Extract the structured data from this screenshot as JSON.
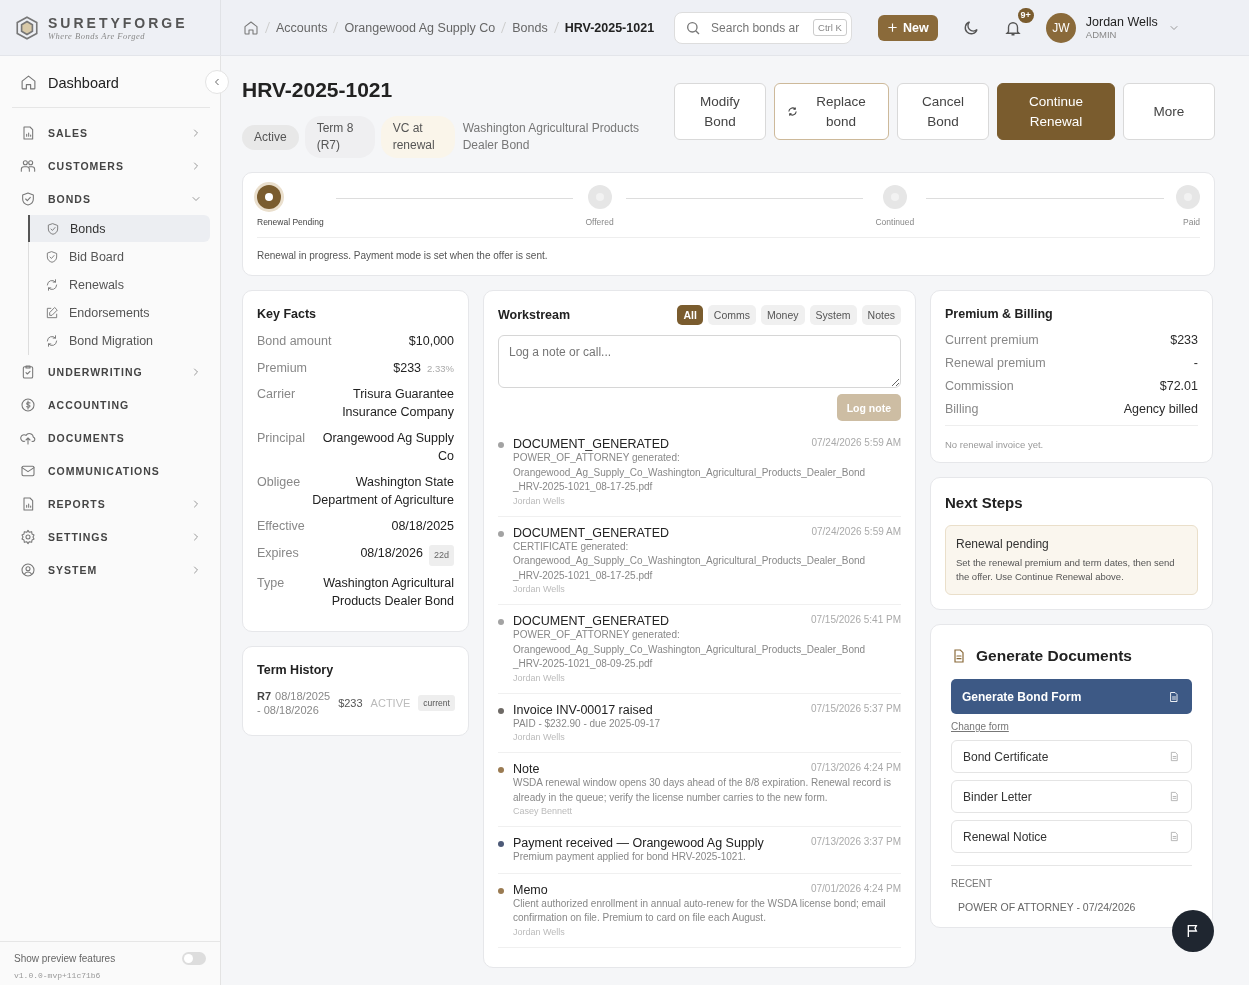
{
  "brand": {
    "name": "SURETYFORGE",
    "tagline": "Where Bonds Are Forged"
  },
  "sidebar": {
    "dashboard": {
      "label": "Dashboard"
    },
    "sections": [
      {
        "label": "SALES",
        "expandable": true,
        "expanded": false
      },
      {
        "label": "CUSTOMERS",
        "expandable": true,
        "expanded": false
      },
      {
        "label": "BONDS",
        "expandable": true,
        "expanded": true,
        "children": [
          {
            "label": "Bonds",
            "selected": true
          },
          {
            "label": "Bid Board",
            "selected": false
          },
          {
            "label": "Renewals",
            "selected": false
          },
          {
            "label": "Endorsements",
            "selected": false
          },
          {
            "label": "Bond Migration",
            "selected": false
          }
        ]
      },
      {
        "label": "UNDERWRITING",
        "expandable": true,
        "expanded": false
      },
      {
        "label": "ACCOUNTING",
        "expandable": false
      },
      {
        "label": "DOCUMENTS",
        "expandable": false
      },
      {
        "label": "COMMUNICATIONS",
        "expandable": false
      },
      {
        "label": "REPORTS",
        "expandable": true,
        "expanded": false
      },
      {
        "label": "SETTINGS",
        "expandable": true,
        "expanded": false
      },
      {
        "label": "SYSTEM",
        "expandable": true,
        "expanded": false
      }
    ],
    "preview": {
      "label": "Show preview features",
      "on": false
    },
    "version": "v1.0.0-mvp+11c71b6"
  },
  "topbar": {
    "breadcrumbs": [
      "Accounts",
      "Orangewood Ag Supply Co",
      "Bonds",
      "HRV-2025-1021"
    ],
    "search": {
      "placeholder": "Search bonds ar",
      "shortcut": "Ctrl K"
    },
    "new_button": "New",
    "notification_badge": "9+",
    "user": {
      "initials": "JW",
      "name": "Jordan Wells",
      "role": "ADMIN"
    }
  },
  "header": {
    "title": "HRV-2025-1021",
    "chips": [
      {
        "label": "Active",
        "kind": "status"
      },
      {
        "label": "Term 8 (R7)",
        "kind": "term"
      },
      {
        "label": "VC at renewal",
        "kind": "warm"
      }
    ],
    "description": "Washington Agricultural Products Dealer Bond",
    "actions": [
      {
        "label": "Modify Bond",
        "kind": "outline"
      },
      {
        "label": "Replace bond",
        "kind": "replace"
      },
      {
        "label": "Cancel Bond",
        "kind": "outline"
      },
      {
        "label": "Continue Renewal",
        "kind": "primary"
      },
      {
        "label": "More",
        "kind": "outline"
      }
    ]
  },
  "progress": {
    "steps": [
      {
        "label": "Renewal Pending",
        "current": true
      },
      {
        "label": "Offered",
        "current": false
      },
      {
        "label": "Continued",
        "current": false
      },
      {
        "label": "Paid",
        "current": false
      }
    ],
    "note": "Renewal in progress. Payment mode is set when the offer is sent."
  },
  "key_facts": {
    "title": "Key Facts",
    "rows": [
      {
        "label": "Bond amount",
        "value": "$10,000"
      },
      {
        "label": "Premium",
        "value": "$233",
        "extra": "2.33%"
      },
      {
        "label": "Carrier",
        "value": "Trisura Guarantee Insurance Company"
      },
      {
        "label": "Principal",
        "value": "Orangewood Ag Supply Co"
      },
      {
        "label": "Obligee",
        "value": "Washington State Department of Agriculture"
      },
      {
        "label": "Effective",
        "value": "08/18/2025"
      },
      {
        "label": "Expires",
        "value": "08/18/2026",
        "badge": "22d"
      },
      {
        "label": "Type",
        "value": "Washington Agricultural Products Dealer Bond"
      }
    ]
  },
  "term_history": {
    "title": "Term History",
    "rows": [
      {
        "term": "R7",
        "dates": "08/18/2025 - 08/18/2026",
        "amount": "$233",
        "status": "ACTIVE",
        "tag": "current"
      }
    ]
  },
  "workstream": {
    "title": "Workstream",
    "filters": [
      {
        "label": "All",
        "selected": true
      },
      {
        "label": "Comms",
        "selected": false
      },
      {
        "label": "Money",
        "selected": false
      },
      {
        "label": "System",
        "selected": false
      },
      {
        "label": "Notes",
        "selected": false
      }
    ],
    "placeholder": "Log a note or call...",
    "log_button": {
      "label": "Log note",
      "disabled": true
    },
    "events": [
      {
        "title": "DOCUMENT_GENERATED",
        "time": "07/24/2026 5:59 AM",
        "body": "POWER_OF_ATTORNEY generated: Orangewood_Ag_Supply_Co_Washington_Agricultural_Products_Dealer_Bond\n_HRV-2025-1021_08-17-25.pdf",
        "author": "Jordan Wells",
        "color": "#a3a3a3"
      },
      {
        "title": "DOCUMENT_GENERATED",
        "time": "07/24/2026 5:59 AM",
        "body": "CERTIFICATE generated: Orangewood_Ag_Supply_Co_Washington_Agricultural_Products_Dealer_Bond\n_HRV-2025-1021_08-17-25.pdf",
        "author": "Jordan Wells",
        "color": "#a3a3a3"
      },
      {
        "title": "DOCUMENT_GENERATED",
        "time": "07/15/2026 5:41 PM",
        "body": "POWER_OF_ATTORNEY generated: Orangewood_Ag_Supply_Co_Washington_Agricultural_Products_Dealer_Bond\n_HRV-2025-1021_08-09-25.pdf",
        "author": "Jordan Wells",
        "color": "#a3a3a3"
      },
      {
        "title": "Invoice INV-00017 raised",
        "time": "07/15/2026 5:37 PM",
        "body": "PAID - $232.90 - due 2025-09-17",
        "author": "Jordan Wells",
        "color": "#6e6a66"
      },
      {
        "title": "Note",
        "time": "07/13/2026 4:24 PM",
        "body": "WSDA renewal window opens 30 days ahead of the 8/8 expiration. Renewal record is already in the queue; verify the license number carries to the new form.",
        "author": "Casey Bennett",
        "color": "#9a7b52"
      },
      {
        "title": "Payment received — Orangewood Ag Supply",
        "time": "07/13/2026 3:37 PM",
        "body": "Premium payment applied for bond HRV-2025-1021.",
        "color": "#4d5a78"
      },
      {
        "title": "Memo",
        "time": "07/01/2026 4:24 PM",
        "body": "Client authorized enrollment in annual auto-renew for the WSDA license bond; email confirmation on file. Premium to card on file each August.",
        "author": "Jordan Wells",
        "color": "#9a7b52"
      }
    ]
  },
  "premium": {
    "title": "Premium & Billing",
    "rows": [
      {
        "label": "Current premium",
        "value": "$233"
      },
      {
        "label": "Renewal premium",
        "value": "-"
      },
      {
        "label": "Commission",
        "value": "$72.01"
      },
      {
        "label": "Billing",
        "value": "Agency billed"
      }
    ],
    "note": "No renewal invoice yet."
  },
  "next_steps": {
    "title": "Next Steps",
    "alert_title": "Renewal pending",
    "alert_text": "Set the renewal premium and term dates, then send the offer. Use Continue Renewal above."
  },
  "documents": {
    "title": "Generate Documents",
    "primary_button": "Generate Bond Form",
    "change_link": "Change form",
    "items": [
      "Bond Certificate",
      "Binder Letter",
      "Renewal Notice"
    ],
    "recent_heading": "RECENT",
    "recent": [
      "POWER OF ATTORNEY - 07/24/2026"
    ]
  }
}
